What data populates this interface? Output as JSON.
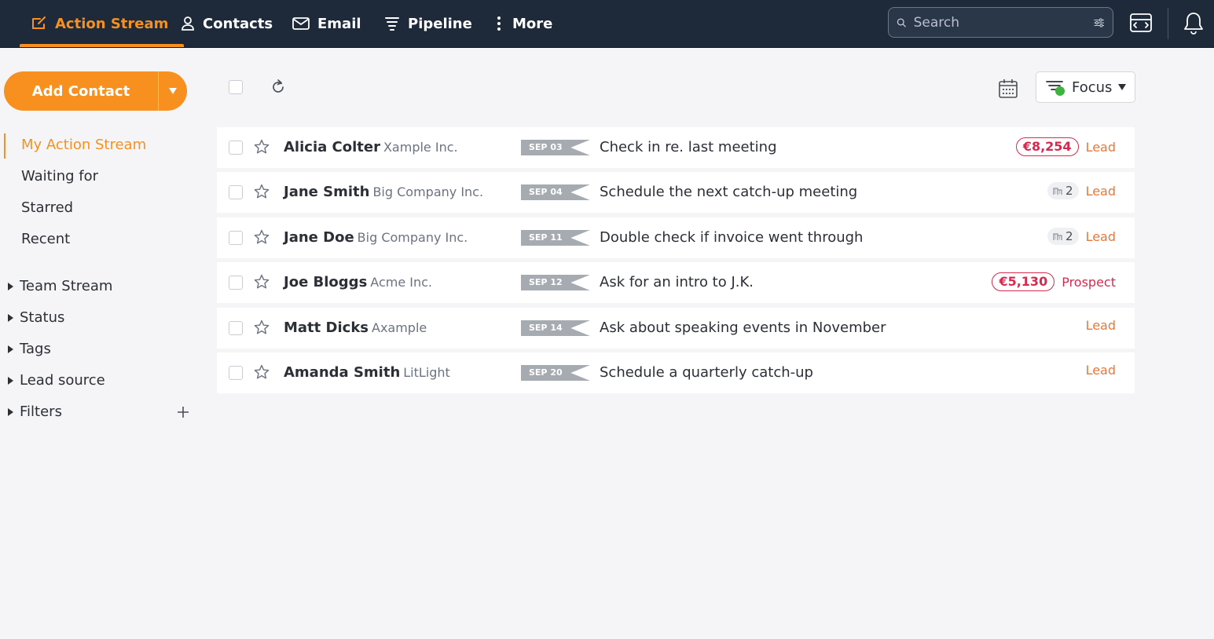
{
  "nav": {
    "items": [
      {
        "label": "Action Stream",
        "icon": "action-stream-icon"
      },
      {
        "label": "Contacts",
        "icon": "contacts-icon"
      },
      {
        "label": "Email",
        "icon": "email-icon"
      },
      {
        "label": "Pipeline",
        "icon": "pipeline-icon"
      },
      {
        "label": "More",
        "icon": "more-vertical-icon"
      }
    ],
    "search_placeholder": "Search"
  },
  "sidebar": {
    "add_contact_label": "Add Contact",
    "items": [
      {
        "label": "My Action Stream"
      },
      {
        "label": "Waiting for"
      },
      {
        "label": "Starred"
      },
      {
        "label": "Recent"
      }
    ],
    "groups": [
      {
        "label": "Team Stream"
      },
      {
        "label": "Status"
      },
      {
        "label": "Tags"
      },
      {
        "label": "Lead source"
      },
      {
        "label": "Filters"
      }
    ]
  },
  "toolbar": {
    "focus_label": "Focus"
  },
  "colors": {
    "accent": "#f7901e",
    "nav_bg": "#1e2a3a",
    "amount": "#d6294e",
    "lead": "#e8783a",
    "prospect": "#d6294e",
    "focus_dot": "#3db33d"
  },
  "rows": [
    {
      "name": "Alicia Colter",
      "company": "Xample Inc.",
      "date": "SEP 03",
      "task": "Check in re. last meeting",
      "amount": "€8,254",
      "count": "",
      "status": "Lead"
    },
    {
      "name": "Jane Smith",
      "company": "Big Company Inc.",
      "date": "SEP 04",
      "task": "Schedule the next catch-up meeting",
      "amount": "",
      "count": "2",
      "status": "Lead"
    },
    {
      "name": "Jane Doe",
      "company": "Big Company Inc.",
      "date": "SEP 11",
      "task": "Double check if invoice went through",
      "amount": "",
      "count": "2",
      "status": "Lead"
    },
    {
      "name": "Joe Bloggs",
      "company": "Acme Inc.",
      "date": "SEP 12",
      "task": "Ask for an intro to J.K.",
      "amount": "€5,130",
      "count": "",
      "status": "Prospect"
    },
    {
      "name": "Matt Dicks",
      "company": "Axample",
      "date": "SEP 14",
      "task": "Ask about speaking events in November",
      "amount": "",
      "count": "",
      "status": "Lead"
    },
    {
      "name": "Amanda Smith",
      "company": "LitLight",
      "date": "SEP 20",
      "task": "Schedule a quarterly catch-up",
      "amount": "",
      "count": "",
      "status": "Lead"
    }
  ]
}
